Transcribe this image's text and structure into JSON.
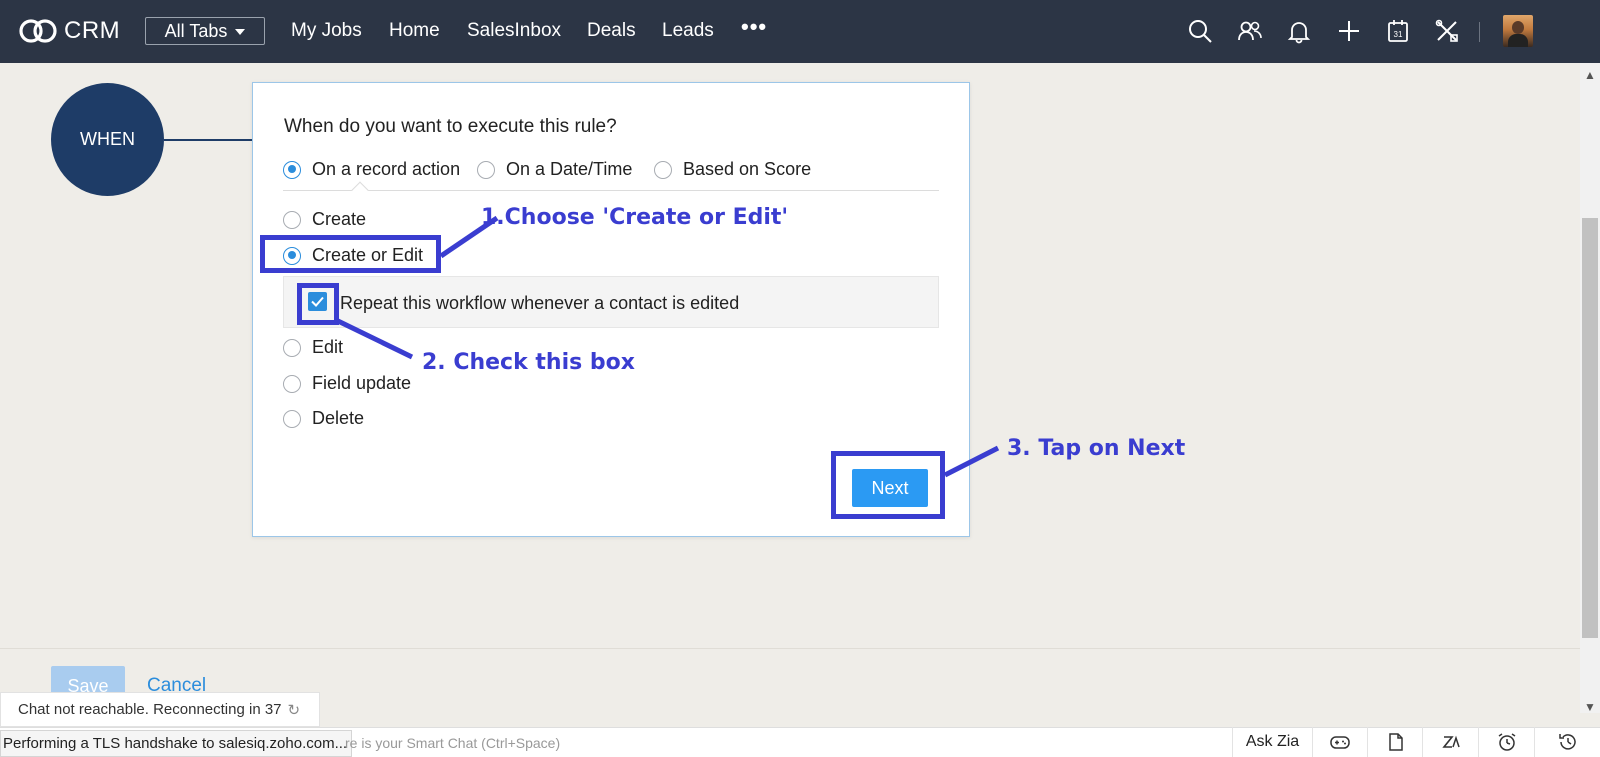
{
  "header": {
    "brand": "CRM",
    "all_tabs": "All Tabs",
    "nav": [
      "My Jobs",
      "Home",
      "SalesInbox",
      "Deals",
      "Leads"
    ],
    "more": "•••",
    "icons": [
      "search-icon",
      "users-icon",
      "bell-icon",
      "plus-icon",
      "calendar-icon",
      "tools-icon",
      "avatar"
    ]
  },
  "workflow": {
    "when_label": "WHEN",
    "question": "When do you want to execute this rule?",
    "trigger_options": [
      {
        "label": "On a record action",
        "selected": true
      },
      {
        "label": "On a Date/Time",
        "selected": false
      },
      {
        "label": "Based on Score",
        "selected": false
      }
    ],
    "actions": [
      {
        "label": "Create",
        "selected": false
      },
      {
        "label": "Create or Edit",
        "selected": true
      },
      {
        "label": "Edit",
        "selected": false
      },
      {
        "label": "Field update",
        "selected": false
      },
      {
        "label": "Delete",
        "selected": false
      }
    ],
    "repeat_label": "Repeat this workflow whenever a contact is edited",
    "repeat_checked": true,
    "next_label": "Next"
  },
  "annotations": {
    "step1": "1.Choose 'Create or Edit'",
    "step2": "2. Check this box",
    "step3": "3. Tap on Next",
    "color": "#3a3dd0"
  },
  "footer": {
    "save_label": "Save",
    "cancel_label": "Cancel"
  },
  "chat": {
    "toast": "Chat not reachable. Reconnecting in 37"
  },
  "status_bar": {
    "tls_text": "Performing a TLS handshake to salesiq.zoho.com...",
    "smart_chat_placeholder": "re is your Smart Chat (Ctrl+Space)",
    "ask_zia": "Ask Zia"
  },
  "colors": {
    "topbar": "#2c3545",
    "accent": "#2b9af3",
    "when_circle": "#1e3c67"
  }
}
